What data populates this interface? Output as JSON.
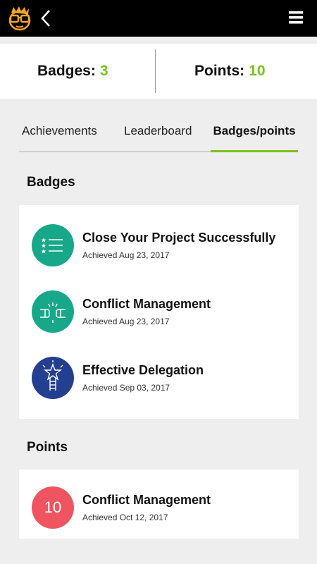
{
  "header": {
    "logo_icon": "glasses-face-logo-icon",
    "back_icon": "chevron-left-icon",
    "menu_icon": "hamburger-menu-icon"
  },
  "stats": {
    "badges_label": "Badges:",
    "badges_value": "3",
    "points_label": "Points:",
    "points_value": "10",
    "accent_color": "#79c21f"
  },
  "tabs": [
    {
      "label": "Achievements",
      "active": false
    },
    {
      "label": "Leaderboard",
      "active": false
    },
    {
      "label": "Badges/points",
      "active": true
    }
  ],
  "badges": {
    "title": "Badges",
    "items": [
      {
        "name": "Close Your Project Successfully",
        "date": "Achieved Aug 23, 2017",
        "icon": "checklist-stars-icon",
        "color": "#17a889"
      },
      {
        "name": "Conflict Management",
        "date": "Achieved Aug 23, 2017",
        "icon": "fist-bump-icon",
        "color": "#17a889"
      },
      {
        "name": "Effective Delegation",
        "date": "Achieved Sep 03, 2017",
        "icon": "ladder-star-icon",
        "color": "#243f90"
      }
    ]
  },
  "points": {
    "title": "Points",
    "items": [
      {
        "value": "10",
        "name": "Conflict Management",
        "date": "Achieved Oct 12, 2017",
        "color": "#ef5560"
      }
    ]
  }
}
